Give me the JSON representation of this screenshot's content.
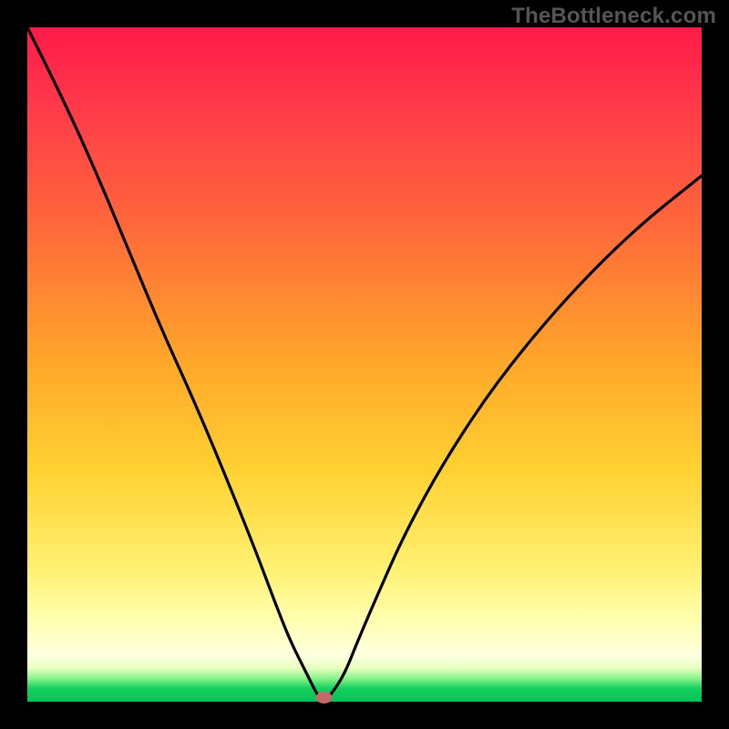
{
  "watermark": "TheBottleneck.com",
  "chart_data": {
    "type": "line",
    "title": "",
    "xlabel": "",
    "ylabel": "",
    "xlim": [
      0,
      100
    ],
    "ylim": [
      0,
      100
    ],
    "grid": false,
    "series": [
      {
        "name": "curve",
        "x": [
          0,
          5,
          10,
          15,
          20,
          25,
          30,
          34,
          37,
          39,
          41,
          42,
          43,
          44,
          45,
          47,
          49,
          52,
          56,
          62,
          70,
          80,
          90,
          100
        ],
        "values": [
          100,
          90,
          79,
          67,
          55,
          44,
          32,
          22,
          14,
          9,
          5,
          3,
          1,
          0,
          1,
          4,
          9,
          16,
          25,
          36,
          48,
          60,
          70,
          78
        ]
      }
    ],
    "marker": {
      "x": 44,
      "y": 0.6
    },
    "background_gradient": {
      "top": "#ff1a4a",
      "mid": "#ffd232",
      "low": "#ffffe0",
      "bottom": "#00c455"
    }
  }
}
